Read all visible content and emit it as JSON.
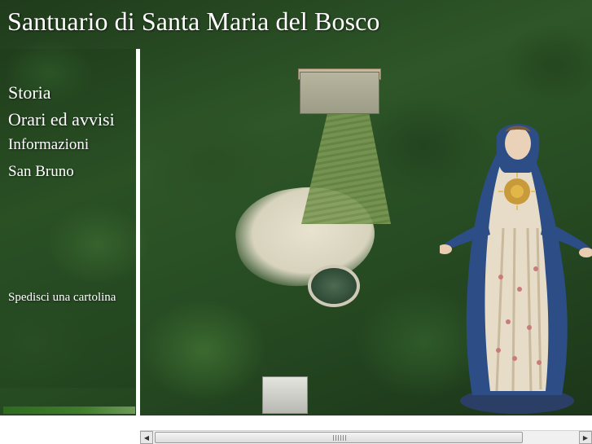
{
  "header": {
    "title": "Santuario di Santa Maria del Bosco"
  },
  "nav": {
    "items": [
      {
        "label": "Storia"
      },
      {
        "label": "Orari ed avvisi"
      },
      {
        "label": "Informazioni"
      },
      {
        "label": "San Bruno"
      }
    ],
    "postcard_label": "Spedisci una cartolina"
  },
  "scrollbar": {
    "left_arrow": "◀",
    "right_arrow": "▶"
  },
  "colors": {
    "accent_green": "#3f7d2b",
    "text": "#ffffff"
  },
  "icons": {
    "scroll_left": "arrow-left-icon",
    "scroll_right": "arrow-right-icon"
  }
}
